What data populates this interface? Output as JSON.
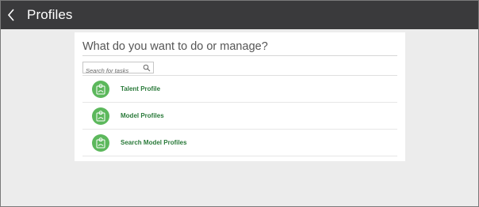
{
  "header": {
    "back_icon": "chevron-left-icon",
    "title": "Profiles"
  },
  "main": {
    "heading": "What do you want to do or manage?",
    "search": {
      "placeholder": "Search for tasks",
      "value": "",
      "icon": "search-icon"
    },
    "tasks": [
      {
        "label": "Talent Profile",
        "icon": "profile-icon"
      },
      {
        "label": "Model Profiles",
        "icon": "profile-icon"
      },
      {
        "label": "Search Model Profiles",
        "icon": "profile-icon"
      }
    ]
  },
  "colors": {
    "topbar": "#3a3a3c",
    "accent_green": "#5cb85c",
    "link_green": "#2a7a3a",
    "background": "#ececec"
  }
}
